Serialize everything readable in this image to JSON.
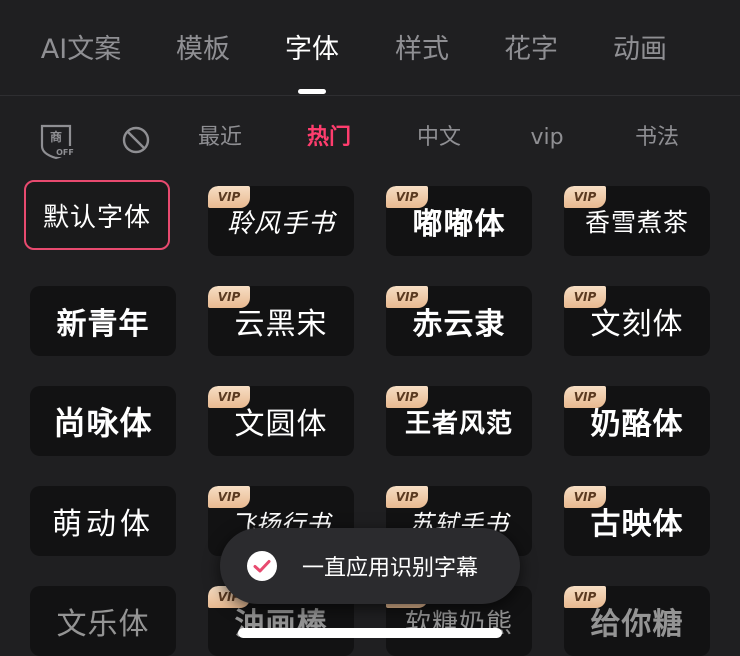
{
  "tabs": {
    "items": [
      {
        "label": "AI文案"
      },
      {
        "label": "模板"
      },
      {
        "label": "字体"
      },
      {
        "label": "样式"
      },
      {
        "label": "花字"
      },
      {
        "label": "动画"
      }
    ],
    "active_index": 2
  },
  "categories": {
    "commercial_icon_text": "商",
    "commercial_icon_sub": "OFF",
    "items": [
      {
        "label": "最近"
      },
      {
        "label": "热门"
      },
      {
        "label": "中文"
      },
      {
        "label": "vip"
      },
      {
        "label": "书法"
      }
    ],
    "active_index": 1
  },
  "fonts": [
    {
      "name": "默认字体",
      "vip": false,
      "selected": true
    },
    {
      "name": "聆风手书",
      "vip": true
    },
    {
      "name": "嘟嘟体",
      "vip": true
    },
    {
      "name": "香雪煮茶",
      "vip": true
    },
    {
      "name": "新青年",
      "vip": false
    },
    {
      "name": "云黑宋",
      "vip": true
    },
    {
      "name": "赤云隶",
      "vip": true
    },
    {
      "name": "文刻体",
      "vip": true
    },
    {
      "name": "尚咏体",
      "vip": false
    },
    {
      "name": "文圆体",
      "vip": true
    },
    {
      "name": "王者风范",
      "vip": true
    },
    {
      "name": "奶酪体",
      "vip": true
    },
    {
      "name": "萌动体",
      "vip": false
    },
    {
      "name": "飞扬行书",
      "vip": true
    },
    {
      "name": "苏轼手书",
      "vip": true
    },
    {
      "name": "古映体",
      "vip": true
    },
    {
      "name": "文乐体",
      "vip": false
    },
    {
      "name": "油画棒",
      "vip": true
    },
    {
      "name": "软糖奶熊",
      "vip": true
    },
    {
      "name": "给你糖",
      "vip": true
    }
  ],
  "vip_badge": "VIP",
  "toast": {
    "text": "一直应用识别字幕"
  },
  "colors": {
    "accent": "#ff3d6e",
    "selected_border": "#e84a6f",
    "vip_gold": "#f2cfae"
  }
}
